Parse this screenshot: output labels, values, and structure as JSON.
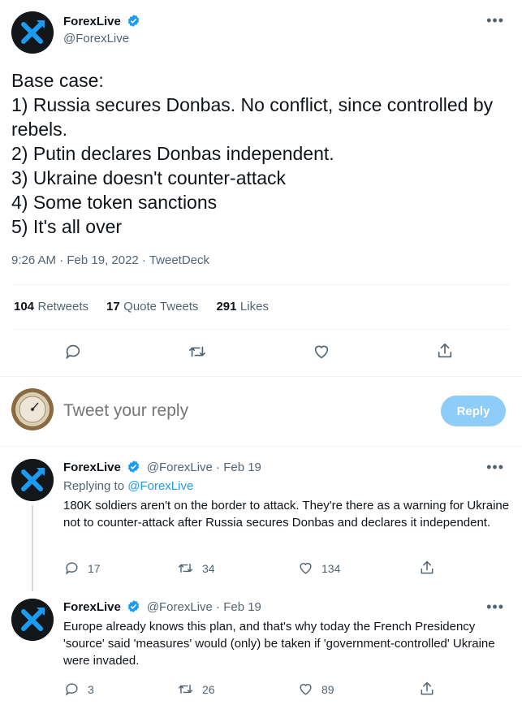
{
  "tweet": {
    "author_name": "ForexLive",
    "author_handle": "@ForexLive",
    "text": "Base case:\n1) Russia secures Donbas. No conflict, since controlled by rebels.\n2) Putin declares Donbas independent.\n3) Ukraine doesn't counter-attack\n4) Some token sanctions\n5) It's all over",
    "meta": "9:26 AM · Feb 19, 2022 · TweetDeck",
    "stats": {
      "retweets_count": "104",
      "retweets_label": "Retweets",
      "quotes_count": "17",
      "quotes_label": "Quote Tweets",
      "likes_count": "291",
      "likes_label": "Likes"
    }
  },
  "composer": {
    "placeholder": "Tweet your reply",
    "button_label": "Reply"
  },
  "replies": [
    {
      "author_name": "ForexLive",
      "handle_date": "@ForexLive · Feb 19",
      "replying_prefix": "Replying to ",
      "replying_handle": "@ForexLive",
      "text": "180K soldiers aren't on the border to attack. They're there as a warning for Ukraine not to counter-attack after Russia secures Donbas and declares it independent.",
      "reply_count": "17",
      "retweet_count": "34",
      "like_count": "134"
    },
    {
      "author_name": "ForexLive",
      "handle_date": "@ForexLive · Feb 19",
      "text": "Europe already knows this plan, and that's why today the French Presidency 'source' said 'measures' would (only) be taken if 'government-controlled' Ukraine were invaded.",
      "reply_count": "3",
      "retweet_count": "26",
      "like_count": "89"
    }
  ],
  "colors": {
    "accent": "#1d9bf0",
    "reply_button_disabled": "#8ecdf8",
    "muted_text": "#536471",
    "divider": "#eff3f4"
  },
  "icons": {
    "more": "more-dots-icon",
    "verified": "verified-badge-icon",
    "reply": "reply-bubble-icon",
    "retweet": "retweet-icon",
    "like": "heart-icon",
    "share": "share-icon"
  }
}
